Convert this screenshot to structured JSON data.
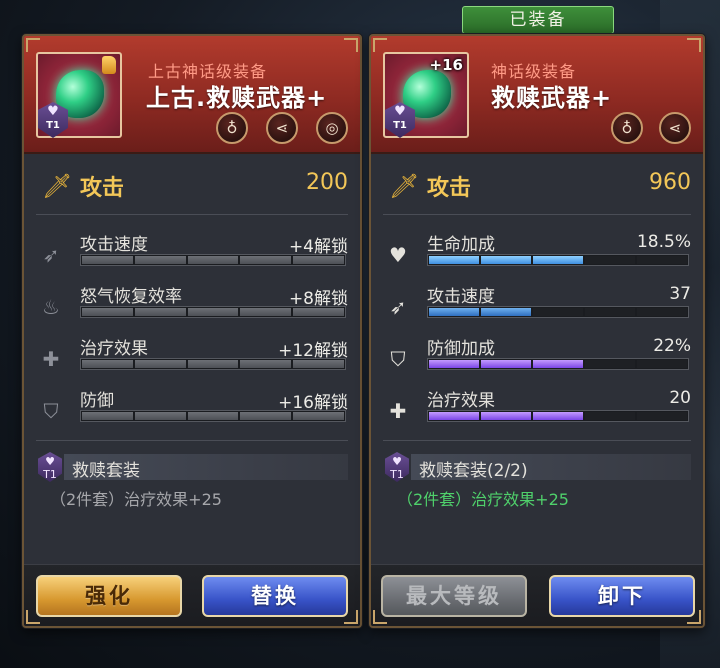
{
  "equipped_tag": "已装备",
  "left": {
    "rarity": "上古神话级装备",
    "name": "上古.救赎武器+",
    "tier": "T1",
    "attack": {
      "label": "攻击",
      "value": "200"
    },
    "stats": [
      {
        "name": "攻击速度",
        "value": "+4解锁",
        "icon": "attack-speed-icon"
      },
      {
        "name": "怒气恢复效率",
        "value": "+8解锁",
        "icon": "rage-recovery-icon"
      },
      {
        "name": "治疗效果",
        "value": "+12解锁",
        "icon": "healing-icon"
      },
      {
        "name": "防御",
        "value": "+16解锁",
        "icon": "defense-icon"
      }
    ],
    "set": {
      "name": "救赎套装",
      "bonus": "（2件套）治疗效果+25"
    },
    "buttons": {
      "primary": "强化",
      "secondary": "替换"
    }
  },
  "right": {
    "rarity": "神话级装备",
    "name": "救赎武器+",
    "plus_level": "+16",
    "tier": "T1",
    "attack": {
      "label": "攻击",
      "value": "960"
    },
    "stats": [
      {
        "name": "生命加成",
        "value": "18.5%",
        "icon": "life-bonus-icon",
        "fill": 0.55
      },
      {
        "name": "攻击速度",
        "value": "37",
        "icon": "attack-speed-icon",
        "fill": 0.33
      },
      {
        "name": "防御加成",
        "value": "22%",
        "icon": "defense-bonus-icon",
        "fill": 0.66
      },
      {
        "name": "治疗效果",
        "value": "20",
        "icon": "healing-icon",
        "fill": 0.6
      }
    ],
    "set": {
      "name": "救赎套装(2/2)",
      "bonus": "（2件套）治疗效果+25"
    },
    "buttons": {
      "primary": "最大等级",
      "secondary": "卸下"
    }
  },
  "colors": {
    "header_red": "#b23b2d",
    "attack_gold": "#f3c758",
    "bar_blue": "#3f8fe0",
    "bar_purple": "#7b46e6",
    "set_active_green": "#4fd06b",
    "set_inactive": "#a6a7ab"
  }
}
